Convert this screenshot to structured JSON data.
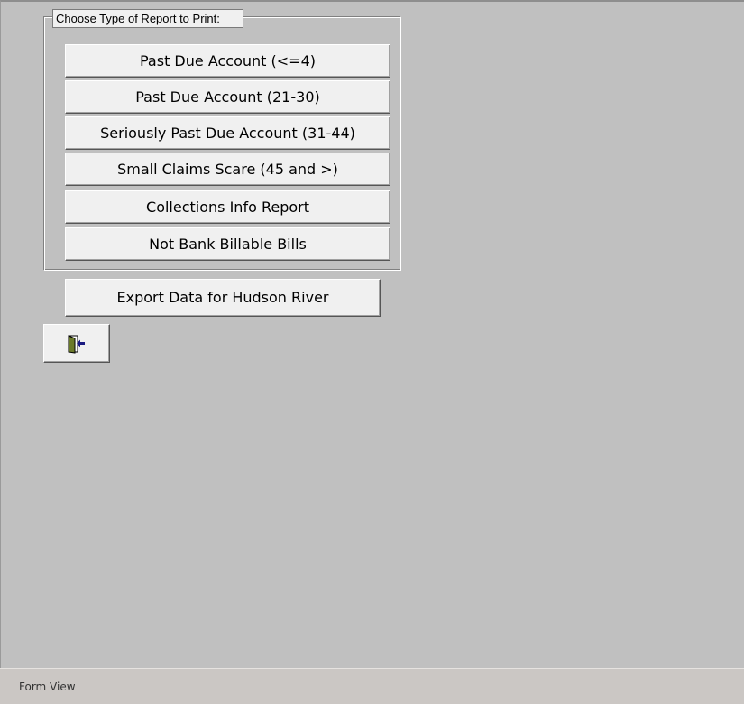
{
  "form": {
    "group_label": "Choose Type of Report to Print:",
    "report_buttons": [
      "Past Due Account  (<=4)",
      "Past Due Account (21-30)",
      "Seriously Past Due Account  (31-44)",
      "Small Claims Scare  (45 and >)",
      "Collections Info Report",
      "Not Bank Billable Bills"
    ],
    "export_button": "Export Data for Hudson River",
    "exit_button_icon": "exit-door-icon"
  },
  "status_bar": {
    "view_label": "Form View"
  },
  "colors": {
    "form_background": "#c0c0c0",
    "button_face": "#f0f0f0",
    "status_bar": "#cbc7c4",
    "door_green": "#6b7a2a",
    "arrow_navy": "#1a1a80"
  }
}
